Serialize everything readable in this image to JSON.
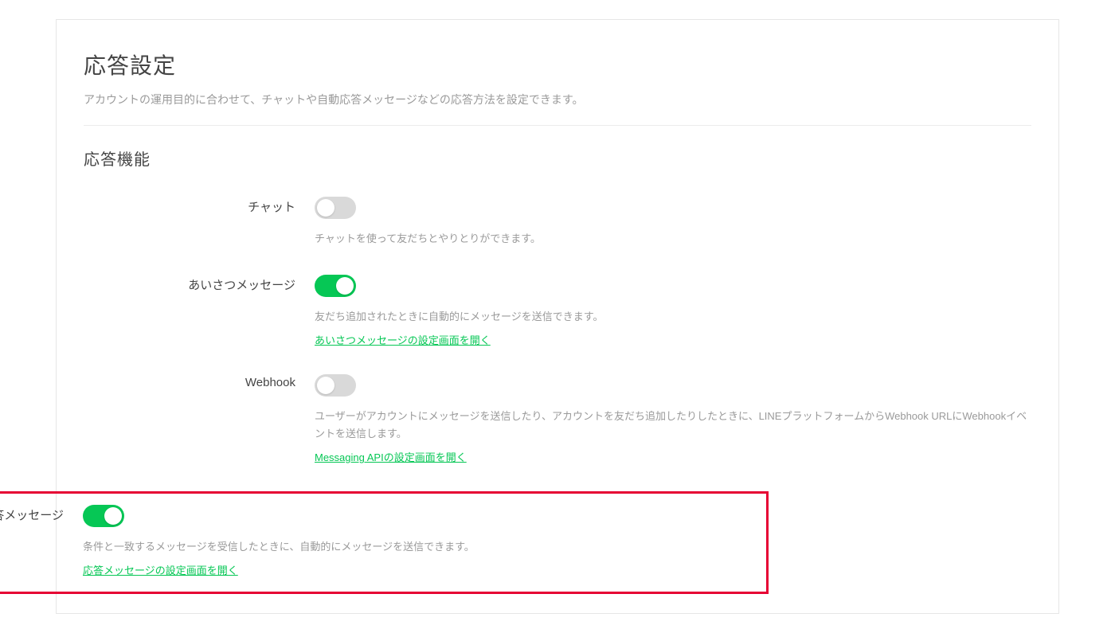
{
  "page": {
    "title": "応答設定",
    "subtitle": "アカウントの運用目的に合わせて、チャットや自動応答メッセージなどの応答方法を設定できます。"
  },
  "section": {
    "title": "応答機能"
  },
  "rows": {
    "chat": {
      "label": "チャット",
      "toggle_on": false,
      "desc": "チャットを使って友だちとやりとりができます。"
    },
    "greeting": {
      "label": "あいさつメッセージ",
      "toggle_on": true,
      "desc": "友だち追加されたときに自動的にメッセージを送信できます。",
      "link": "あいさつメッセージの設定画面を開く"
    },
    "webhook": {
      "label": "Webhook",
      "toggle_on": false,
      "desc": "ユーザーがアカウントにメッセージを送信したり、アカウントを友だち追加したりしたときに、LINEプラットフォームからWebhook URLにWebhookイベントを送信します。",
      "link": "Messaging APIの設定画面を開く"
    },
    "autoreply": {
      "label": "応答メッセージ",
      "toggle_on": true,
      "desc": "条件と一致するメッセージを受信したときに、自動的にメッセージを送信できます。",
      "link": "応答メッセージの設定画面を開く"
    }
  }
}
